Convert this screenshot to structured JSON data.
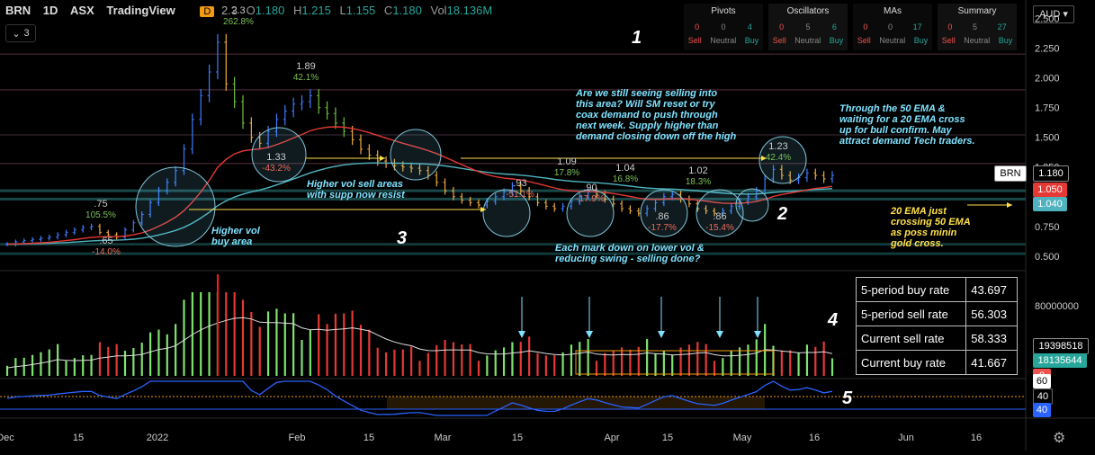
{
  "header": {
    "symbol": "BRN",
    "interval": "1D",
    "exchange": "ASX",
    "source": "TradingView",
    "badge": "D",
    "open_label": "O",
    "open": "1.180",
    "high_label": "H",
    "high": "1.215",
    "low_label": "L",
    "low": "1.155",
    "close_label": "C",
    "close": "1.180",
    "vol_label": "Vol",
    "vol": "18.136M",
    "collapse_count": "3",
    "ticker_fragment": "2.3"
  },
  "technicals": [
    {
      "title": "Pivots",
      "counts": [
        "0",
        "0",
        "4"
      ]
    },
    {
      "title": "Oscillators",
      "counts": [
        "0",
        "5",
        "6"
      ]
    },
    {
      "title": "MAs",
      "counts": [
        "0",
        "0",
        "17"
      ]
    },
    {
      "title": "Summary",
      "counts": [
        "0",
        "5",
        "27"
      ]
    }
  ],
  "technical_labels": [
    "Sell",
    "Neutral",
    "Buy"
  ],
  "currency": "AUD",
  "stats_table": [
    {
      "label": "5-period buy rate",
      "value": "43.697"
    },
    {
      "label": "5-period sell rate",
      "value": "56.303"
    },
    {
      "label": "Current sell rate",
      "value": "58.333"
    },
    {
      "label": "Current buy rate",
      "value": "41.667"
    }
  ],
  "annotations": {
    "n1": "1",
    "n2": "2",
    "n3": "3",
    "n4": "4",
    "n5": "5",
    "q1": "Are we still seeing selling into",
    "q2": "this area? Will SM reset or try",
    "q3": "coax demand to push through",
    "q4": "next week. Supply higher than",
    "q5": "demand closing down off the high",
    "t1": "Through the 50 EMA &",
    "t2": "waiting for a 20 EMA cross",
    "t3": "up for bull confirm. May",
    "t4": "attract demand Tech traders.",
    "h1": "Higher vol sell areas",
    "h2": "with supp now resist",
    "b1": "Higher vol",
    "b2": "buy area",
    "m1": "Each mark down on lower vol &",
    "m2": "reducing swing - selling done?",
    "e1": "20 EMA just",
    "e2": "crossing 50 EMA",
    "e3": "as poss minin",
    "e4": "gold cross."
  },
  "price_tags": {
    "symbol": "BRN",
    "last": "1.180",
    "ema20": "1.050",
    "ema50": "1.040"
  },
  "volume_tags": {
    "v1": "19398518",
    "v2": "18135644",
    "v3": "0",
    "axis": "80000000"
  },
  "osc_tags": {
    "t60": "60",
    "t40a": "40",
    "t40b": "40"
  },
  "colors": {
    "up": "#26a69a",
    "down": "#ef5350",
    "ema20": "#e53935",
    "ema50": "#4fb3bf",
    "note": "#7fe3ff",
    "yellow": "#ffe04a",
    "osc": "#2962ff",
    "osc_orange": "#f39c12"
  },
  "chart_data": {
    "type": "candlestick",
    "y_ticks": [
      "2.500",
      "2.250",
      "2.000",
      "1.750",
      "1.500",
      "1.250",
      "1.000",
      "0.750",
      "0.500"
    ],
    "ylim": [
      0.4,
      2.55
    ],
    "x_ticks": [
      "Dec",
      "15",
      "2022",
      "Feb",
      "15",
      "Mar",
      "15",
      "Apr",
      "15",
      "May",
      "16",
      "Jun",
      "16"
    ],
    "price_series": [
      0.6,
      0.62,
      0.63,
      0.64,
      0.65,
      0.66,
      0.68,
      0.7,
      0.72,
      0.74,
      0.75,
      0.7,
      0.68,
      0.66,
      0.72,
      0.78,
      0.85,
      0.95,
      1.05,
      1.12,
      1.22,
      1.4,
      1.65,
      1.85,
      2.05,
      2.3,
      1.95,
      1.8,
      1.62,
      1.5,
      1.45,
      1.55,
      1.65,
      1.72,
      1.78,
      1.8,
      1.85,
      1.75,
      1.7,
      1.62,
      1.55,
      1.48,
      1.4,
      1.35,
      1.3,
      1.28,
      1.26,
      1.25,
      1.24,
      1.22,
      1.18,
      1.12,
      1.05,
      1.0,
      0.97,
      0.95,
      0.93,
      0.96,
      1.0,
      1.04,
      1.09,
      1.05,
      1.0,
      0.95,
      0.92,
      0.9,
      0.92,
      0.96,
      1.0,
      1.04,
      1.02,
      0.98,
      0.94,
      0.9,
      0.88,
      0.86,
      0.9,
      0.95,
      1.0,
      1.02,
      0.98,
      0.94,
      0.9,
      0.88,
      0.86,
      0.88,
      0.92,
      0.96,
      1.0,
      1.05,
      1.15,
      1.23,
      1.18,
      1.14,
      1.16,
      1.2,
      1.18,
      1.15,
      1.18
    ],
    "price_labels": [
      {
        "price": ".75",
        "pct": "105.5%"
      },
      {
        "price": ".65",
        "pct": "-14.0%"
      },
      {
        "price": "2.3",
        "pct": "262.8%"
      },
      {
        "price": "1.33",
        "pct": "-43.2%"
      },
      {
        "price": "1.89",
        "pct": "42.1%"
      },
      {
        "price": ".93",
        "pct": "-51.1%"
      },
      {
        "price": "1.09",
        "pct": "17.8%"
      },
      {
        "price": ".90",
        "pct": "-17.9%"
      },
      {
        "price": "1.04",
        "pct": "16.8%"
      },
      {
        "price": ".86",
        "pct": "-17.7%"
      },
      {
        "price": "1.02",
        "pct": "18.3%"
      },
      {
        "price": ".86",
        "pct": "-15.4%"
      },
      {
        "price": "1.23",
        "pct": "42.4%"
      }
    ]
  }
}
